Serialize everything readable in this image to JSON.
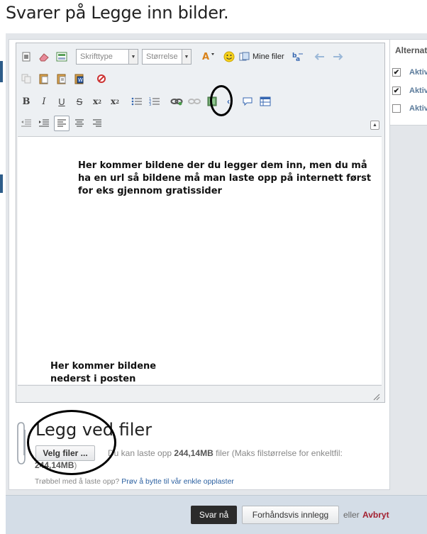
{
  "page": {
    "title": "Svarer på Legge inn bilder."
  },
  "toolbar": {
    "font_select": "Skrifttype",
    "size_select": "Størrelse",
    "mine_filer": "Mine filer"
  },
  "editor": {
    "text_top": "Her kommer bildene der du legger dem inn, men du må ha en url så bildene må man laste opp på internett først for eks gjennom gratissider",
    "text_bottom_line1": "Her kommer bildene",
    "text_bottom_line2": "nederst i posten"
  },
  "attachments": {
    "title": "Legg ved filer",
    "choose_button": "Velg filer ...",
    "info_prefix": "Du kan laste opp ",
    "info_size": "244,14MB",
    "info_middle": " filer (Maks filstørrelse for enkeltfil:",
    "info_size2": "244,14MB",
    "info_suffix": ")",
    "help_prefix": "Trøbbel med å laste opp?",
    "help_link": "Prøv å bytte til vår enkle opplaster"
  },
  "footer": {
    "submit": "Svar nå",
    "preview": "Forhåndsvis innlegg",
    "or": "eller",
    "cancel": "Avbryt"
  },
  "sidebar": {
    "title": "Alternativer",
    "items": [
      {
        "label": "Aktiver",
        "checked": true
      },
      {
        "label": "Aktiver",
        "checked": true
      },
      {
        "label": "Aktiver",
        "checked": false
      }
    ]
  }
}
